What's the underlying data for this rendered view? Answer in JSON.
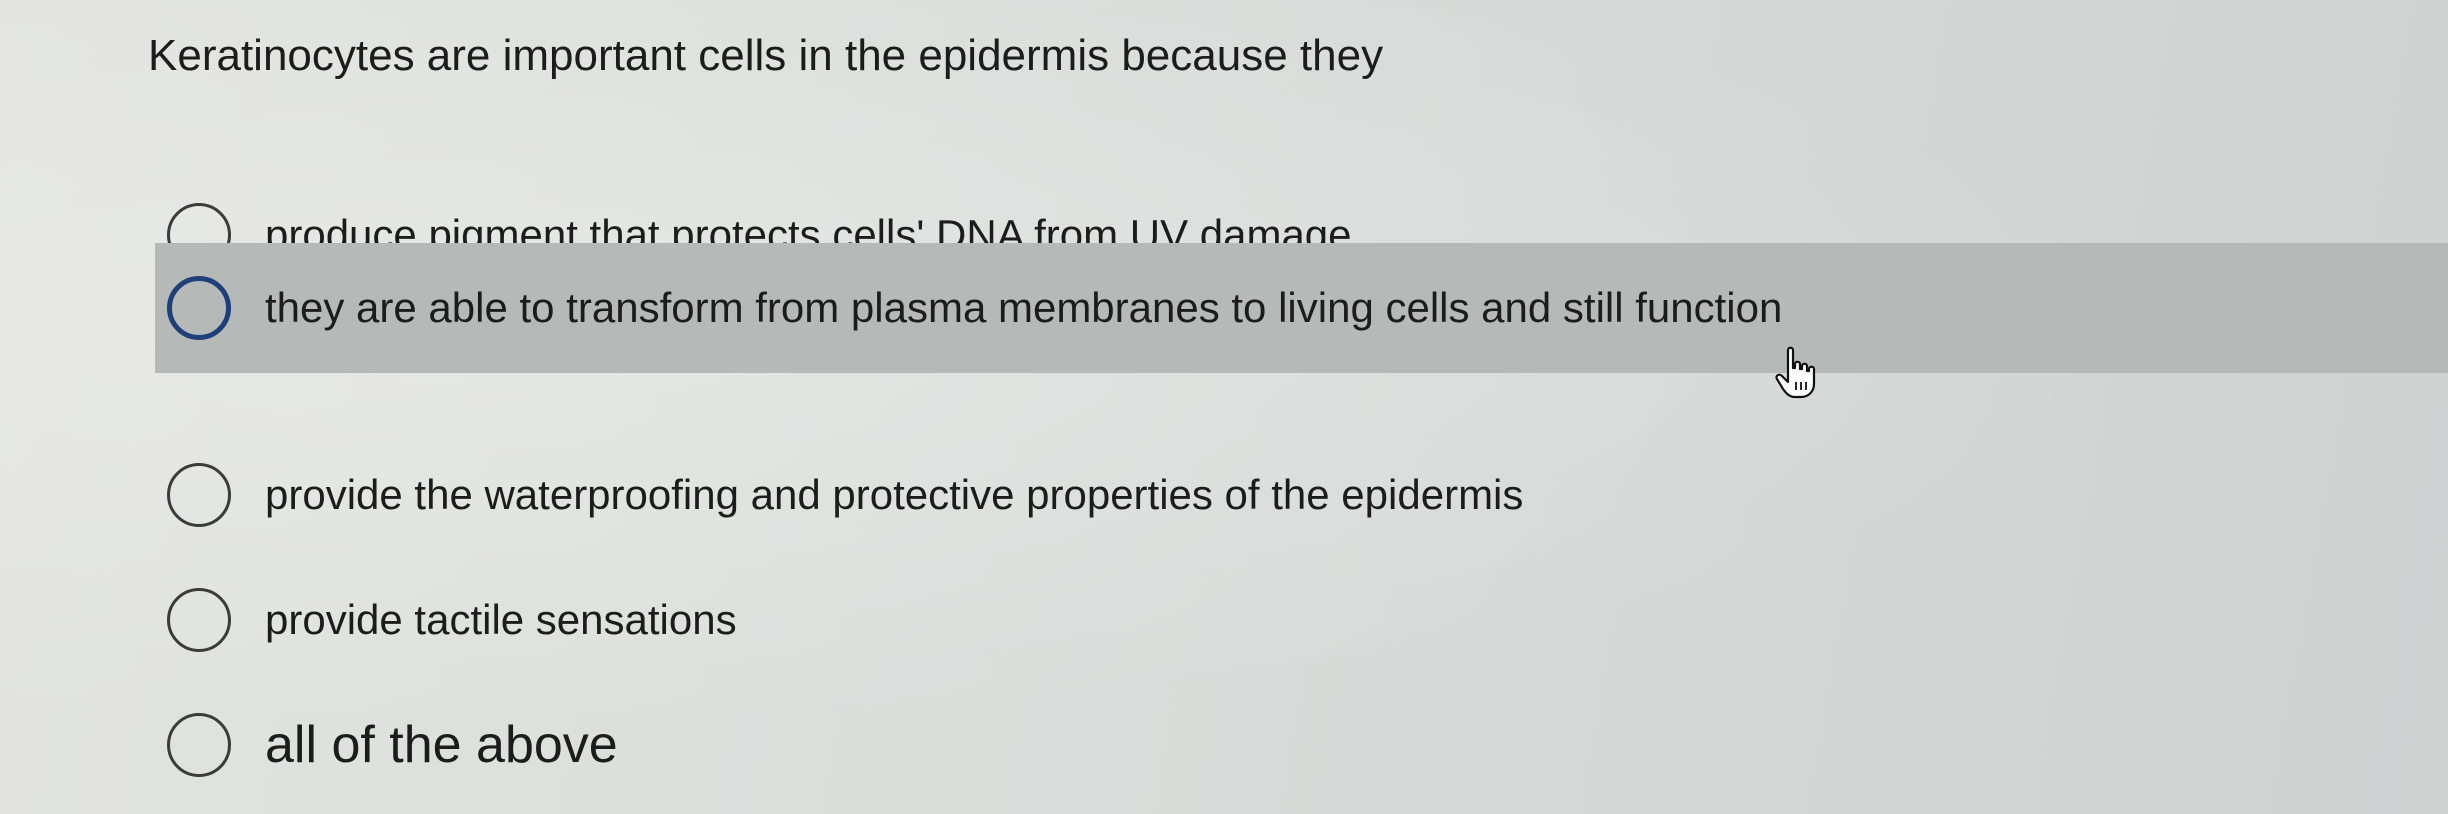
{
  "question": {
    "text": "Keratinocytes are important cells in the epidermis because they"
  },
  "options": [
    {
      "label": "produce pigment that protects cells' DNA from UV damage",
      "selected": false
    },
    {
      "label": "they are able to transform from plasma membranes to living cells and still function",
      "selected": false,
      "hovered": true
    },
    {
      "label": "provide the waterproofing and protective properties of the epidermis",
      "selected": false
    },
    {
      "label": "provide tactile sensations",
      "selected": false
    },
    {
      "label": "all of the above",
      "selected": false
    }
  ],
  "cursor": {
    "icon": "hand-pointer-icon"
  },
  "colors": {
    "hover_row": "#b5b9b7",
    "focus_ring": "#1f3f7a"
  }
}
